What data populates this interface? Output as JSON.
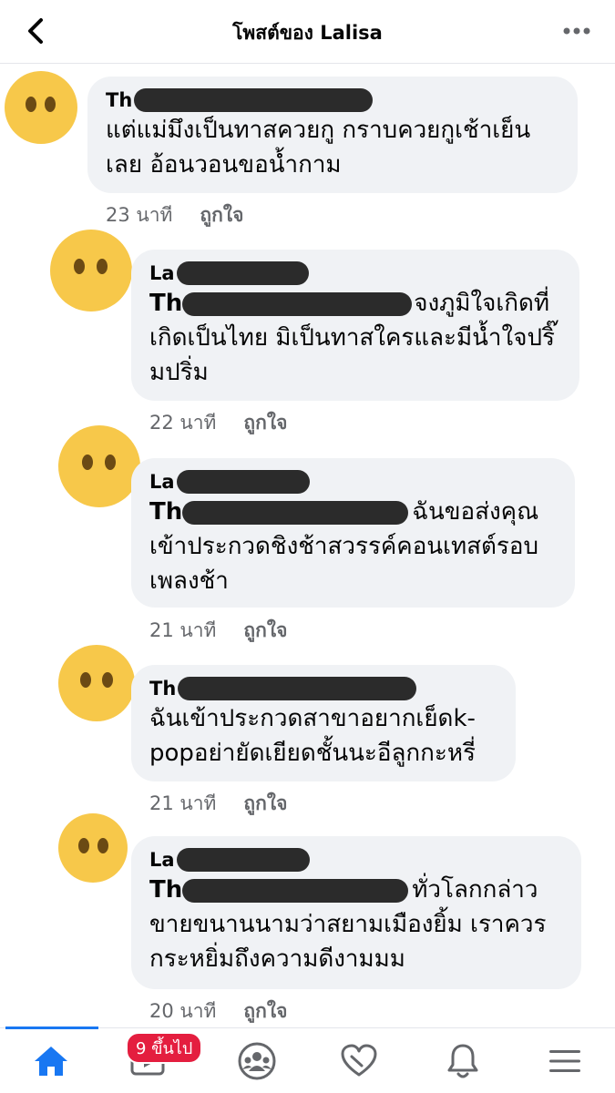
{
  "header": {
    "title": "โพสต์ของ Lalisa"
  },
  "comments": [
    {
      "author_prefix": "Th",
      "lead": "",
      "text": "แต่แม่มึงเป็นทาสควยกู กราบควยกูเช้าเย็นเลย อ้อนวอนขอน้ำกาม",
      "time": "23 นาที",
      "like": "ถูกใจ"
    },
    {
      "author_prefix": "La",
      "lead": "Th",
      "text": "จงภูมิใจเกิดที่เกิดเป็นไทย มิเป็นทาสใครและมีน้ำใจปริ๊มปริ่ม",
      "time": "22 นาที",
      "like": "ถูกใจ"
    },
    {
      "author_prefix": "La",
      "lead": "Th",
      "text": "ฉันขอส่งคุณเข้าประกวดชิงช้าสวรรค์คอนเทสต์รอบเพลงช้า",
      "time": "21 นาที",
      "like": "ถูกใจ"
    },
    {
      "author_prefix": "Th",
      "lead": "",
      "text": "ฉันเข้าประกวดสาขาอยากเย็ดk-popอย่ายัดเยียดชั้นนะอีลูกกะหรี่",
      "time": "21 นาที",
      "like": "ถูกใจ"
    },
    {
      "author_prefix": "La",
      "lead": "Th",
      "text": "ทั่วโลกกล่าวขายขนานนามว่าสยามเมืองยิ้ม เราควรกระหยิ่มถึงความดีงามมม",
      "time": "20 นาที",
      "like": "ถูกใจ"
    }
  ],
  "bottom_nav": {
    "watch_badge": "9 ขึ้นไป"
  },
  "colors": {
    "accent": "#1877f2",
    "badge": "#e41e3f",
    "bubble": "#f0f2f5",
    "avatar": "#f7c84a"
  },
  "icons": [
    "back-arrow-icon",
    "more-dots-icon",
    "home-icon",
    "watch-icon",
    "groups-icon",
    "dating-heart-icon",
    "bell-icon",
    "menu-icon"
  ]
}
